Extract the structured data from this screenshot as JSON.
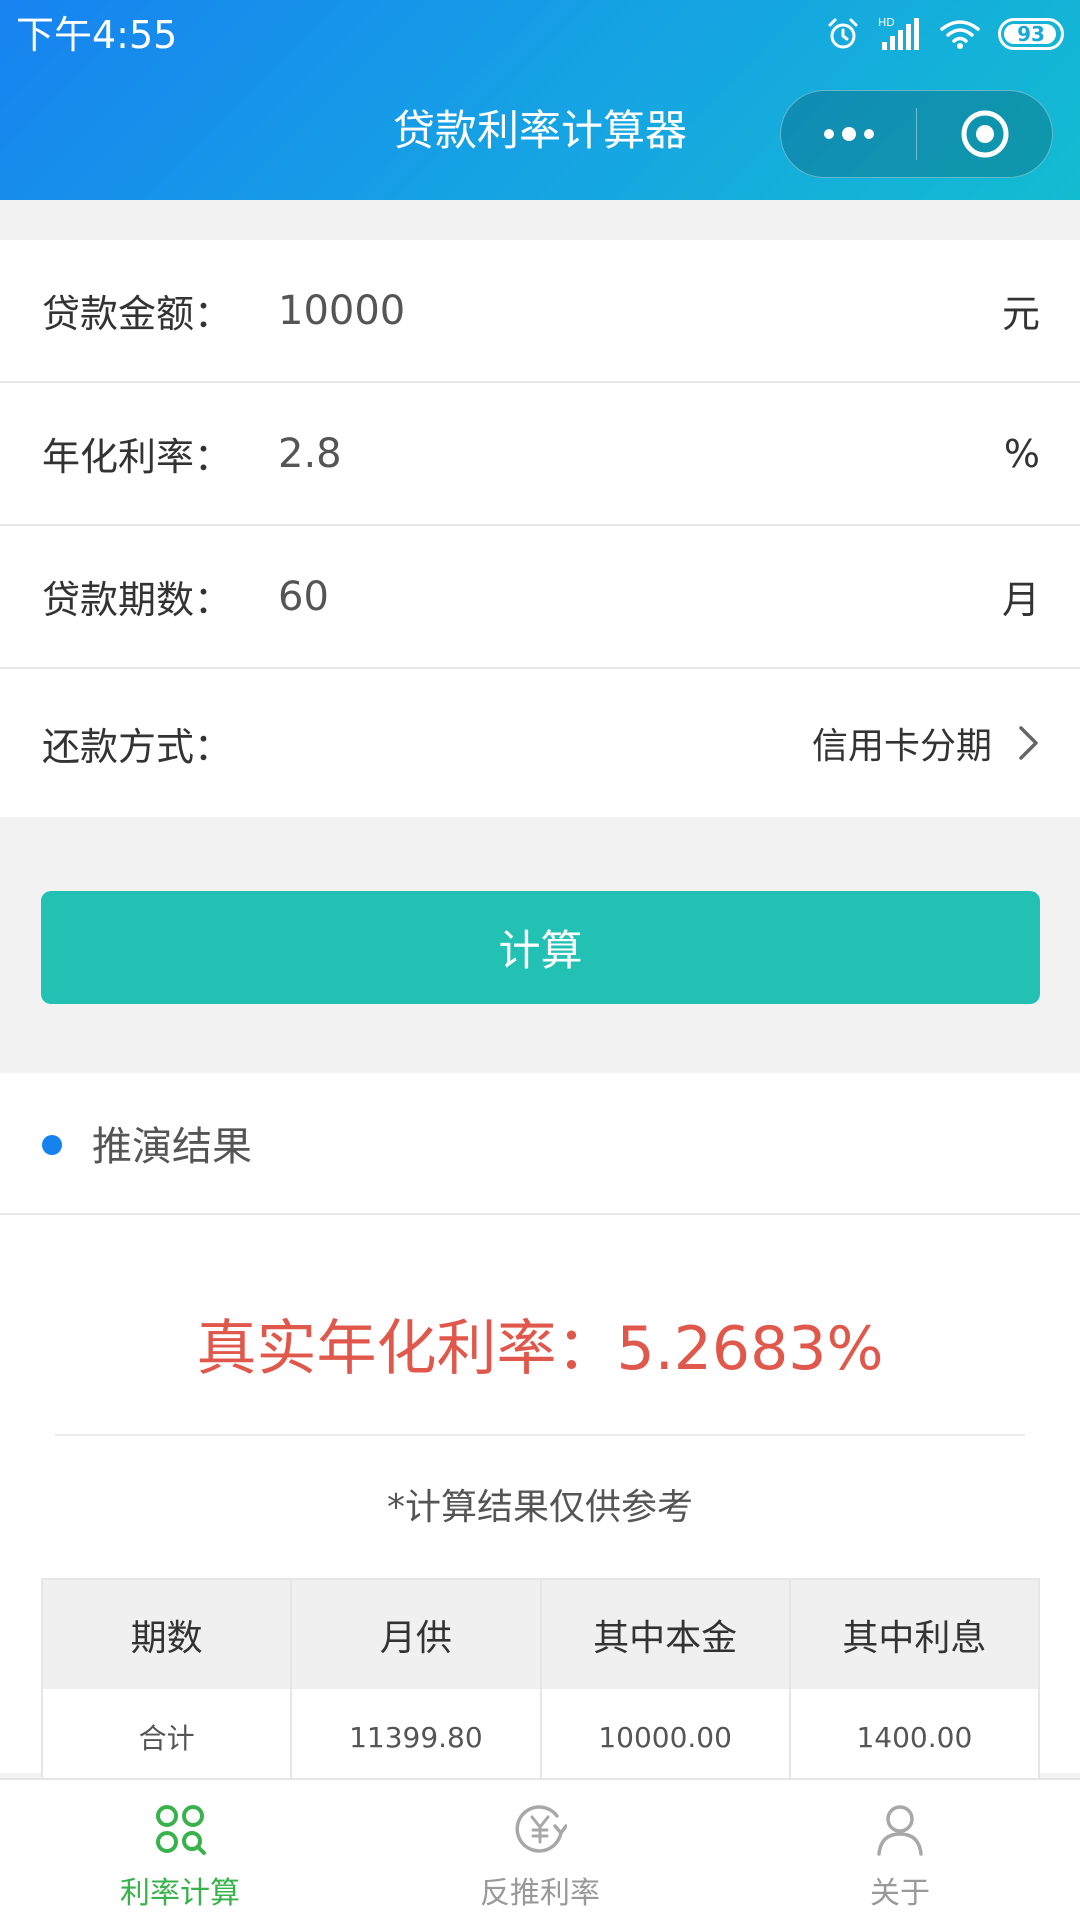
{
  "status_bar": {
    "time": "下午4:55",
    "battery": "93",
    "hd": "HD"
  },
  "nav": {
    "title": "贷款利率计算器"
  },
  "form": {
    "amount": {
      "label": "贷款金额：",
      "value": "10000",
      "unit": "元"
    },
    "rate": {
      "label": "年化利率：",
      "value": "2.8",
      "unit": "%"
    },
    "periods": {
      "label": "贷款期数：",
      "value": "60",
      "unit": "月"
    },
    "method": {
      "label": "还款方式：",
      "value": "信用卡分期"
    }
  },
  "calc_button": "计算",
  "results": {
    "section_title": "推演结果",
    "real_rate": "真实年化利率：5.2683%",
    "note": "*计算结果仅供参考",
    "table": {
      "headers": [
        "期数",
        "月供",
        "其中本金",
        "其中利息"
      ],
      "rows": [
        [
          "合计",
          "11399.80",
          "10000.00",
          "1400.00"
        ]
      ]
    }
  },
  "tabbar": {
    "items": [
      {
        "label": "利率计算",
        "icon": "rate-calc-icon",
        "active": true
      },
      {
        "label": "反推利率",
        "icon": "yuan-reverse-icon",
        "active": false
      },
      {
        "label": "关于",
        "icon": "user-icon",
        "active": false
      }
    ]
  },
  "colors": {
    "header_start": "#1782f0",
    "header_end": "#12bcd0",
    "button": "#22c1b4",
    "result_accent": "#e0584b",
    "dot": "#1582ee",
    "tab_active": "#38b24a"
  }
}
